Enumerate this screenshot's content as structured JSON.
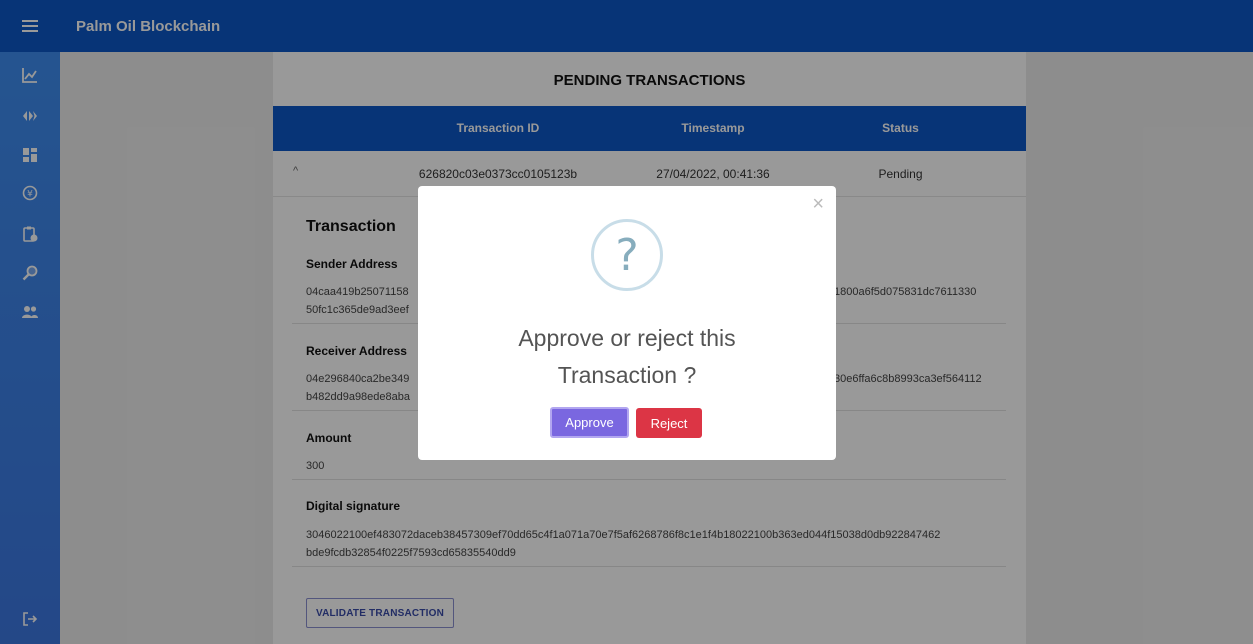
{
  "app": {
    "title": "Palm Oil Blockchain"
  },
  "sidebar": {
    "icons": [
      {
        "name": "chart-line-icon"
      },
      {
        "name": "blockchain-icon"
      },
      {
        "name": "dashboard-icon"
      },
      {
        "name": "exchange-icon"
      },
      {
        "name": "clipboard-clock-icon"
      },
      {
        "name": "search-icon"
      },
      {
        "name": "users-icon"
      }
    ],
    "bottom_icon": "logout-icon"
  },
  "pending": {
    "title": "PENDING TRANSACTIONS",
    "columns": [
      "Transaction ID",
      "Timestamp",
      "Status"
    ],
    "row": {
      "id": "626820c03e0373cc0105123b",
      "timestamp": "27/04/2022, 00:41:36",
      "status": "Pending"
    }
  },
  "transaction": {
    "heading": "Transaction",
    "sender_label": "Sender Address",
    "sender_line1_left": "04caa419b25071158",
    "sender_line1_right": "1800a6f5d075831dc7611330",
    "sender_line2_left": "50fc1c365de9ad3eef",
    "receiver_label": "Receiver Address",
    "receiver_line1_left": "04e296840ca2be349",
    "receiver_line1_right": "30e6ffa6c8b8993ca3ef564112",
    "receiver_line2_left": "b482dd9a98ede8aba",
    "amount_label": "Amount",
    "amount_value": "300",
    "signature_label": "Digital signature",
    "signature_line1": "3046022100ef483072daceb38457309ef70dd65c4f1a071a70e7f5af6268786f8c1e1f4b18022100b363ed044f15038d0db922847462",
    "signature_line2": "bde9fcdb32854f0225f7593cd65835540dd9",
    "validate_label": "VALIDATE TRANSACTION"
  },
  "modal": {
    "icon": "question-icon",
    "text_line1": "Approve or reject this",
    "text_line2": "Transaction ?",
    "approve_label": "Approve",
    "reject_label": "Reject",
    "close_glyph": "×"
  },
  "colors": {
    "topbar": "#0d57c6",
    "sidebar": "#3c7fe8",
    "approve": "#7a67e0",
    "reject": "#dc3545"
  }
}
